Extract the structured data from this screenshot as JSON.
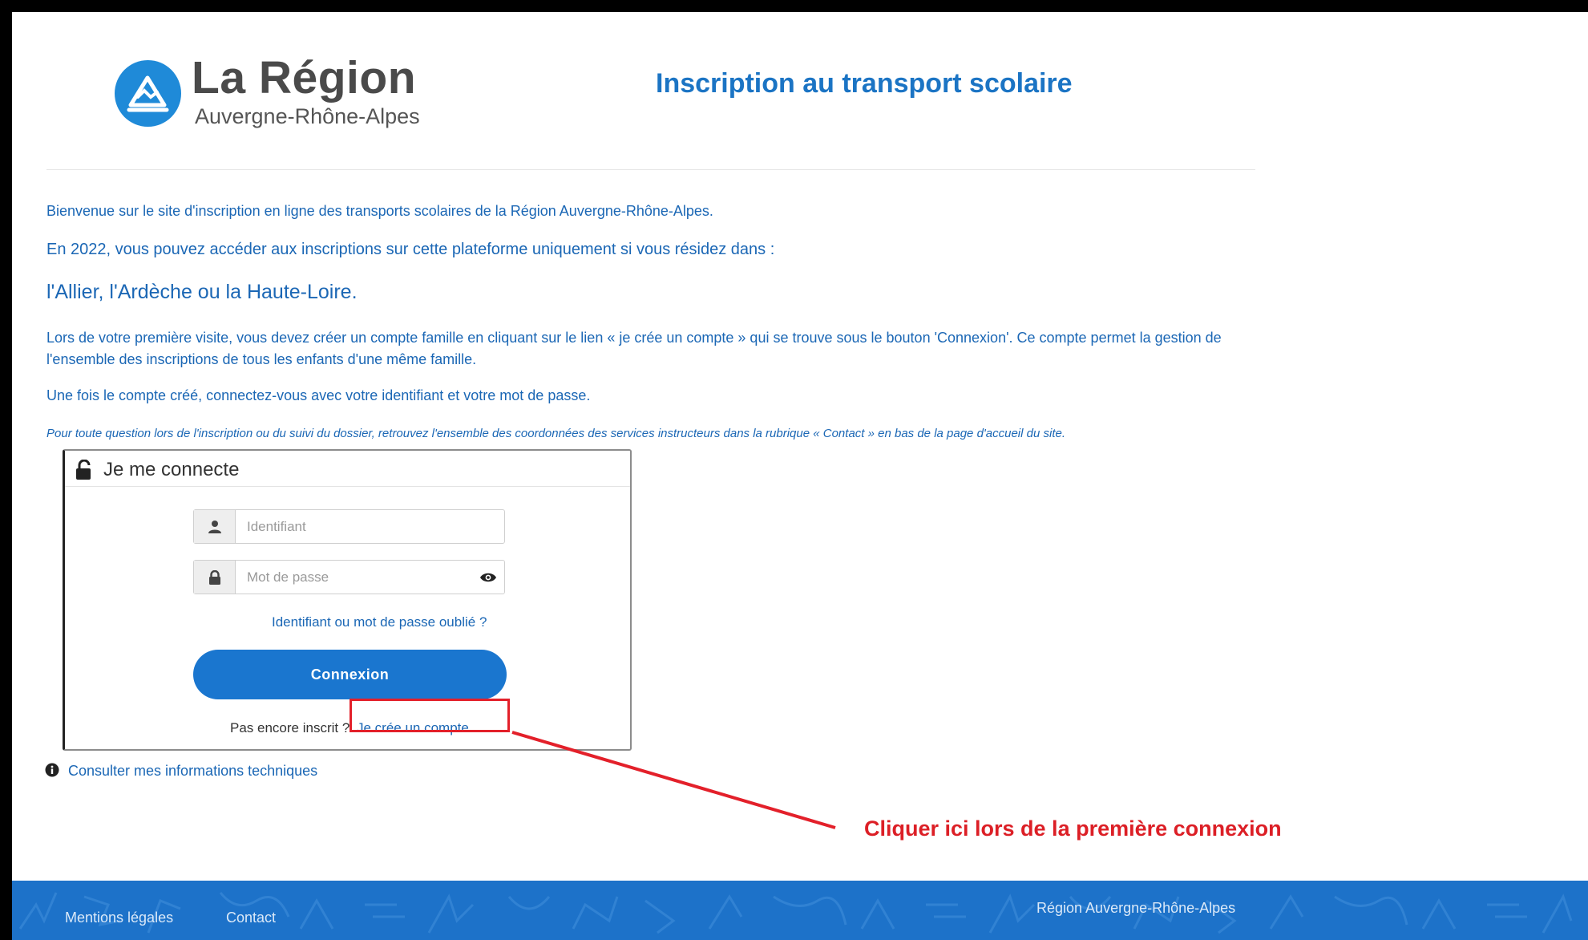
{
  "header": {
    "logo_title": "La Région",
    "logo_subtitle": "Auvergne-Rhône-Alpes",
    "site_title": "Inscription au transport scolaire"
  },
  "intro": {
    "p1": "Bienvenue sur le site d'inscription en ligne des transports scolaires de la Région Auvergne-Rhône-Alpes.",
    "p2": "En 2022, vous pouvez accéder aux inscriptions sur cette plateforme uniquement si vous résidez dans :",
    "p3": "l'Allier, l'Ardèche ou la Haute-Loire.",
    "p4": "Lors de votre première visite, vous devez créer un compte famille en cliquant sur le lien « je crée un compte » qui se trouve sous le bouton 'Connexion'. Ce compte permet la gestion de l'ensemble des inscriptions de tous les enfants d'une même famille.",
    "p5": "Une fois le compte créé, connectez-vous avec votre identifiant et votre mot de passe.",
    "p6": "Pour toute question lors de l'inscription ou du suivi du dossier, retrouvez l'ensemble des coordonnées des services instructeurs dans la rubrique « Contact » en bas de la page d'accueil du site."
  },
  "login": {
    "title": "Je me connecte",
    "id_placeholder": "Identifiant",
    "pw_placeholder": "Mot de passe",
    "forgot_link": "Identifiant ou mot de passe oublié ?",
    "connect_button": "Connexion",
    "signup_text": "Pas encore inscrit ?",
    "signup_link": "Je crée un compte"
  },
  "tech_info_link": "Consulter mes informations techniques",
  "annotation": "Cliquer ici lors de la première connexion",
  "footer": {
    "mentions": "Mentions légales",
    "contact": "Contact",
    "region": "Région Auvergne-Rhône-Alpes"
  },
  "colors": {
    "primary_blue": "#1b67b5",
    "button_blue": "#1a76cf",
    "annotation_red": "#dc1f26"
  },
  "icons": [
    "logo-mountain-icon",
    "unlock-icon",
    "user-icon",
    "lock-icon",
    "eye-icon",
    "info-icon"
  ]
}
